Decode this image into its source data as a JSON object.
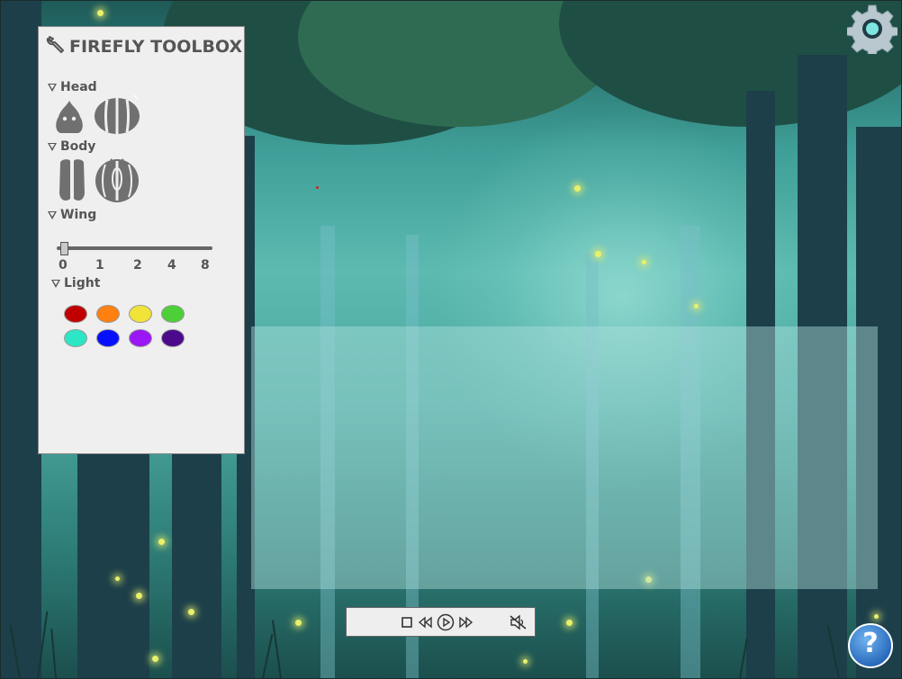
{
  "toolbox": {
    "title": "FIREFLY TOOLBOX",
    "sections": {
      "head": "Head",
      "body": "Body",
      "wing": "Wing",
      "light": "Light"
    },
    "wing_slider": {
      "ticks": [
        "0",
        "1",
        "2",
        "4",
        "8"
      ],
      "value": 0
    },
    "light_colors": [
      "#c00000",
      "#ff7f11",
      "#f2e339",
      "#4ccf37",
      "#2de6c5",
      "#0610ff",
      "#9b16f5",
      "#4b0a8c"
    ]
  },
  "player": {
    "controls": [
      "stop",
      "rewind",
      "play",
      "fast-forward",
      "mute"
    ]
  },
  "icons": {
    "settings": "gear-icon",
    "help": "help-icon",
    "toolbox_tool": "wrench-icon"
  },
  "help_label": "?"
}
